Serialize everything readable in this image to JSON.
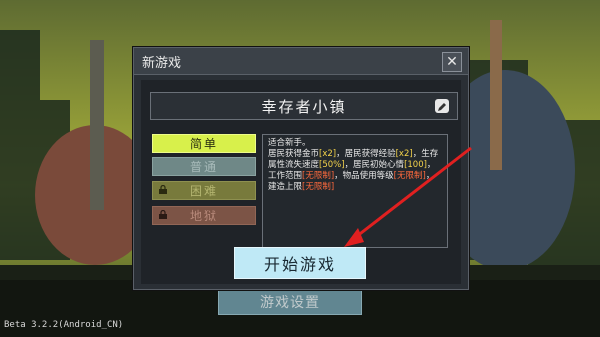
{
  "dialog": {
    "title": "新游戏",
    "close_label": "✕",
    "town_name": "幸存者小镇",
    "difficulties": [
      {
        "label": "简单",
        "selected": true,
        "locked": false
      },
      {
        "label": "普通",
        "selected": false,
        "locked": false
      },
      {
        "label": "困难",
        "selected": false,
        "locked": true
      },
      {
        "label": "地狱",
        "selected": false,
        "locked": true
      }
    ],
    "description": {
      "line1": "适合新手。",
      "p1": "居民获得金币",
      "v1": "[x2]",
      "p2": "，居民获得经验",
      "v2": "[x2]",
      "p3": "，生存属性流失速度",
      "v3": "[50%]",
      "p4": "，居民初始心情",
      "v4": "[100]",
      "p5": "，工作范围",
      "v5": "[无限制]",
      "p6": "，物品使用等级",
      "v6": "[无限制]",
      "p7": "，建造上限",
      "v7": "[无限制]"
    },
    "start_label": "开始游戏"
  },
  "bottom_button_label": "游戏设置",
  "version": "Beta 3.2.2(Android_CN)"
}
